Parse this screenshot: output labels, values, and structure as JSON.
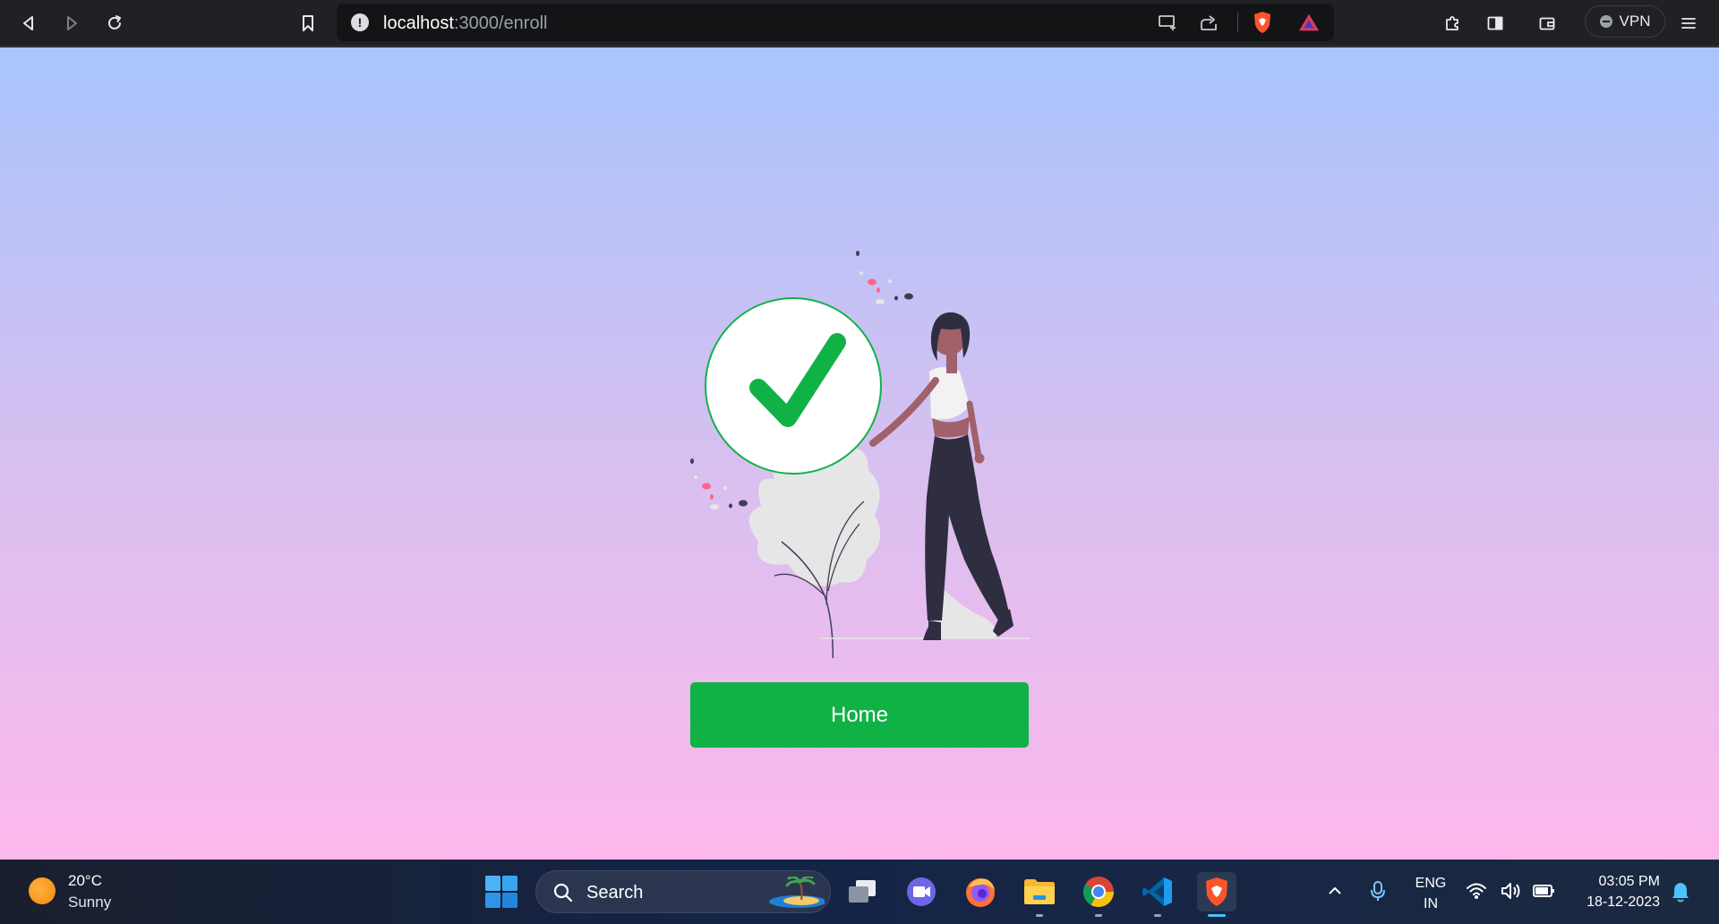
{
  "browser": {
    "url_host": "localhost",
    "url_path": ":3000/enroll",
    "vpn_label": "VPN",
    "icons": [
      "back-icon",
      "forward-icon",
      "reload-icon",
      "bookmark-icon",
      "site-info-icon",
      "cast-icon",
      "share-icon",
      "brave-shields-icon",
      "brave-rewards-icon",
      "extensions-icon",
      "sidebar-icon",
      "wallet-icon",
      "menu-icon"
    ]
  },
  "page": {
    "home_button_label": "Home",
    "colors": {
      "gradient_top": "#a9c4fd",
      "gradient_bottom": "#fdb8eb",
      "success_green": "#10b246"
    },
    "illustration": "success-checkmark-illustration"
  },
  "taskbar": {
    "weather": {
      "temperature": "20°C",
      "condition": "Sunny"
    },
    "search_label": "Search",
    "apps": [
      "task-view",
      "teams",
      "firefox",
      "file-explorer",
      "chrome",
      "vscode",
      "brave"
    ],
    "language": {
      "line1": "ENG",
      "line2": "IN"
    },
    "clock": {
      "time": "03:05 PM",
      "date": "18-12-2023"
    }
  }
}
